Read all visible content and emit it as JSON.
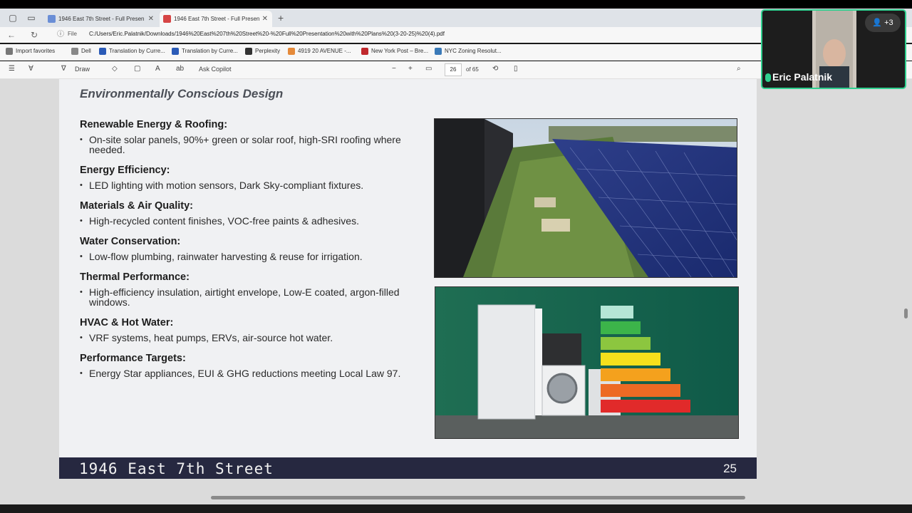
{
  "browser": {
    "tabs": [
      {
        "title": "1946 East 7th Street - Full Presen",
        "active": false,
        "favicon_color": "#6a8ed6"
      },
      {
        "title": "1946 East 7th Street - Full Presen",
        "active": true,
        "favicon_color": "#d64545"
      }
    ],
    "new_tab_icon": "plus-icon",
    "file_label": "File",
    "url": "C:/Users/Eric.Palatnik/Downloads/1946%20East%207th%20Street%20-%20Full%20Presentation%20with%20Plans%20(3-20-25)%20(4).pdf",
    "bookmarks": [
      {
        "label": "Import favorites",
        "color": "#777777"
      },
      {
        "label": "Dell",
        "color": "#888888"
      },
      {
        "label": "Translation by Curre...",
        "color": "#2b5bb7"
      },
      {
        "label": "Translation by Curre...",
        "color": "#2b5bb7"
      },
      {
        "label": "Perplexity",
        "color": "#333333"
      },
      {
        "label": "4919 20 AVENUE -...",
        "color": "#e58a3a"
      },
      {
        "label": "New York Post – Bre...",
        "color": "#c0282d"
      },
      {
        "label": "NYC Zoning Resolut...",
        "color": "#3a7ab8"
      }
    ]
  },
  "pdf_toolbar": {
    "draw_label": "Draw",
    "ask_copilot_label": "Ask Copilot",
    "zoom_out": "−",
    "zoom_in": "+",
    "page_current": "26",
    "page_total": "of 65"
  },
  "slide": {
    "title": "Environmentally Conscious Design",
    "sections": [
      {
        "heading": "Renewable Energy & Roofing:",
        "bullet": "On-site solar panels, 90%+ green or solar roof, high-SRI roofing where needed."
      },
      {
        "heading": "Energy Efficiency:",
        "bullet": "LED lighting with motion sensors, Dark Sky-compliant fixtures."
      },
      {
        "heading": "Materials & Air Quality:",
        "bullet": "High-recycled content finishes, VOC-free paints & adhesives."
      },
      {
        "heading": "Water Conservation:",
        "bullet": "Low-flow plumbing, rainwater harvesting & reuse for irrigation."
      },
      {
        "heading": "Thermal Performance:",
        "bullet": "High-efficiency insulation, airtight envelope, Low-E coated, argon-filled windows."
      },
      {
        "heading": "HVAC & Hot Water:",
        "bullet": "VRF systems, heat pumps, ERVs, air-source hot water."
      },
      {
        "heading": "Performance Targets:",
        "bullet": "Energy Star appliances, EUI & GHG reductions meeting Local Law 97."
      }
    ],
    "footer_title": "1946 East 7th Street",
    "footer_page": "25"
  },
  "video": {
    "participant_name": "Eric Palatnik",
    "participant_count": "+3"
  },
  "colors": {
    "accent_green": "#2fd08f",
    "footer_band": "#262840"
  }
}
